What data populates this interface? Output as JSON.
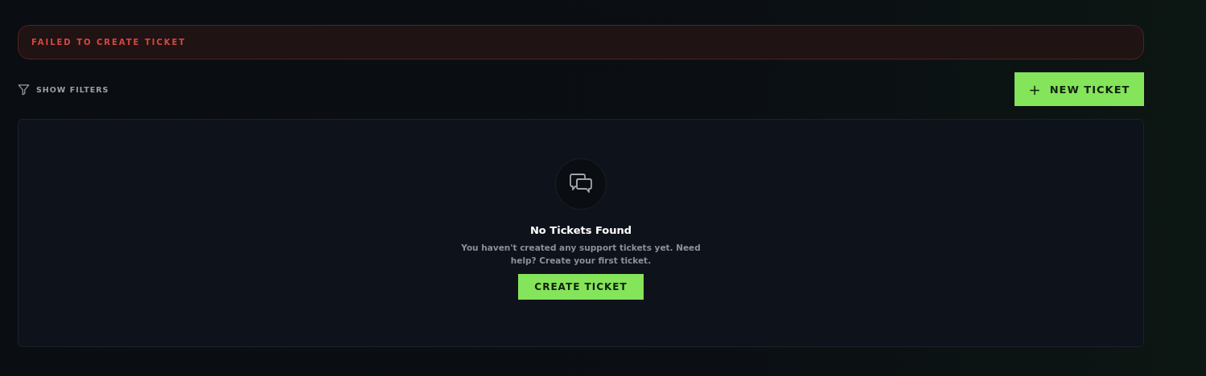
{
  "alert": {
    "message": "FAILED TO CREATE TICKET"
  },
  "toolbar": {
    "filter_toggle": "SHOW FILTERS",
    "new_button": {
      "icon": "+",
      "label": "NEW TICKET"
    }
  },
  "empty_state": {
    "title": "No Tickets Found",
    "description": "You haven't created any support tickets yet. Need help? Create your first ticket.",
    "action": "CREATE TICKET"
  }
}
